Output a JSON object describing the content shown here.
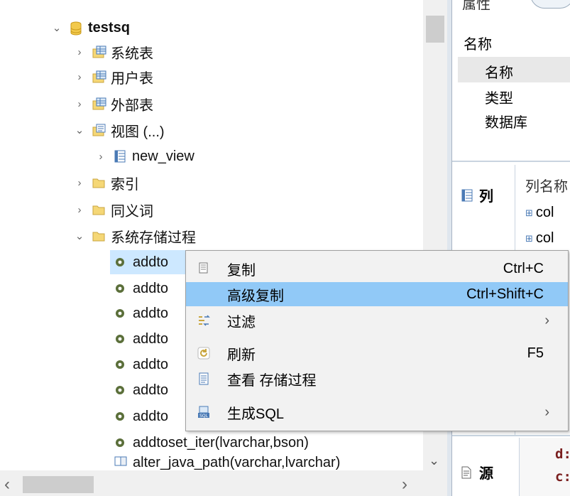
{
  "tree": {
    "root": {
      "label": "testsq"
    },
    "items": [
      {
        "label": "系统表"
      },
      {
        "label": "用户表"
      },
      {
        "label": "外部表"
      },
      {
        "label": "视图 (...)"
      },
      {
        "label": "new_view"
      },
      {
        "label": "索引"
      },
      {
        "label": "同义词"
      },
      {
        "label": "系统存储过程"
      }
    ],
    "procedures": [
      {
        "label": "addto"
      },
      {
        "label": "addto"
      },
      {
        "label": "addto"
      },
      {
        "label": "addto"
      },
      {
        "label": "addto"
      },
      {
        "label": "addto"
      },
      {
        "label": "addto"
      },
      {
        "label": "addtoset_iter(lvarchar,bson)"
      },
      {
        "label": "alter_java_path(varchar,lvarchar)"
      }
    ]
  },
  "right_panel": {
    "tab_label": "属性",
    "name_header": "名称",
    "props": [
      "名称",
      "类型",
      "数据库"
    ],
    "columns_label": "列",
    "column_header": "列名称",
    "columns": [
      "col",
      "col"
    ],
    "source_label": "源",
    "source_lines": [
      "d:",
      "c:"
    ]
  },
  "context_menu": {
    "items": [
      {
        "label": "复制",
        "shortcut": "Ctrl+C"
      },
      {
        "label": "高级复制",
        "shortcut": "Ctrl+Shift+C"
      },
      {
        "label": "过滤",
        "arrow": "›"
      },
      {
        "label": "刷新",
        "shortcut": "F5"
      },
      {
        "label": "查看 存储过程"
      },
      {
        "label": "生成SQL",
        "arrow": "›"
      }
    ]
  },
  "scroll": {
    "left": "‹",
    "right": "›",
    "down": "⌄"
  },
  "colors": {
    "selection": "#cde8ff",
    "menu_hover": "#91c9f7",
    "db_icon": "#f2c94c",
    "folder": "#f5d776"
  }
}
